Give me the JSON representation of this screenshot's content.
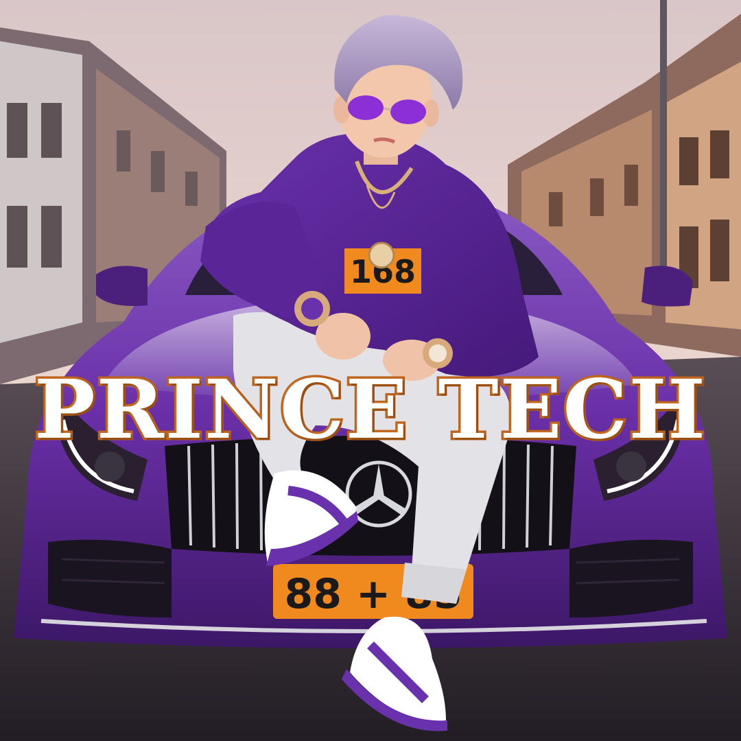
{
  "overlay": {
    "title": "PRINCE TECH"
  },
  "scene": {
    "hoodie_badge": "168",
    "license_plate": "88 + 85"
  },
  "colors": {
    "car": "#6b2fa8",
    "hoodie": "#5a2596",
    "hair": "#a99bc6",
    "plate": "#f08a1e",
    "sky": "#e9d6d0",
    "title_stroke": "#b8621e"
  }
}
